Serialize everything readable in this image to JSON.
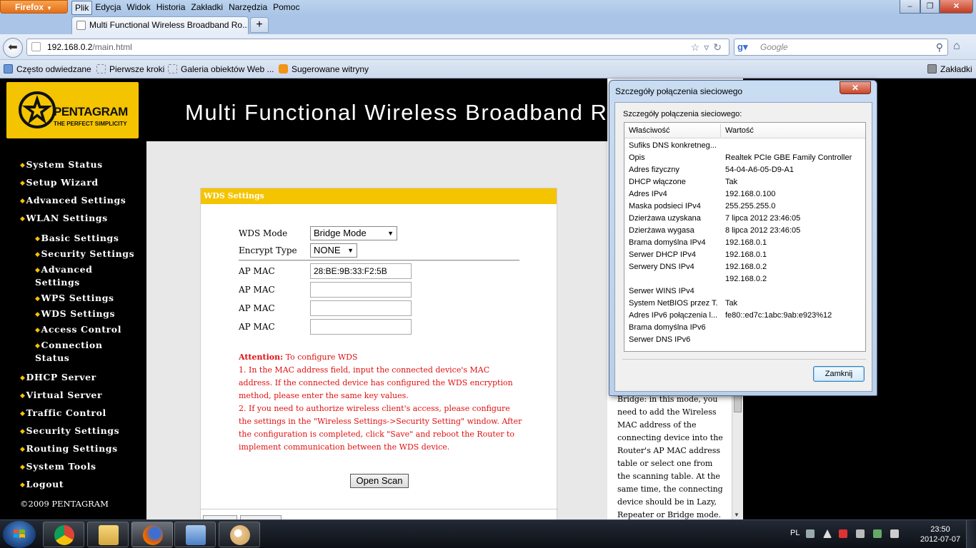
{
  "browser": {
    "app_button": "Firefox",
    "menu": [
      "Plik",
      "Edycja",
      "Widok",
      "Historia",
      "Zakładki",
      "Narzędzia",
      "Pomoc"
    ],
    "tab_title": "Multi Functional Wireless Broadband Ro...",
    "new_tab": "+",
    "url_host": "192.168.0.2",
    "url_path": "/main.html",
    "search_placeholder": "Google",
    "bookmarks": [
      "Często odwiedzane",
      "Pierwsze kroki",
      "Galeria obiektów Web ...",
      "Sugerowane witryny"
    ],
    "bookmarks_menu": "Zakładki",
    "window_controls": [
      "–",
      "❐",
      "✕"
    ]
  },
  "router": {
    "brand": "PENTAGRAM",
    "tagline": "THE PERFECT SIMPLICITY",
    "page_title": "Multi Functional Wireless Broadband Ro",
    "nav": {
      "system_status": "System Status",
      "setup_wizard": "Setup Wizard",
      "advanced_settings": "Advanced Settings",
      "wlan_settings": "WLAN Settings",
      "basic_settings": "Basic Settings",
      "security_settings_sub": "Security Settings",
      "advanced_settings_sub_1": "Advanced",
      "advanced_settings_sub_2": "Settings",
      "wps_settings": "WPS Settings",
      "wds_settings": "WDS Settings",
      "access_control": "Access Control",
      "connection_status_1": "Connection",
      "connection_status_2": "Status",
      "dhcp_server": "DHCP Server",
      "virtual_server": "Virtual Server",
      "traffic_control": "Traffic Control",
      "security_settings": "Security Settings",
      "routing_settings": "Routing Settings",
      "system_tools": "System Tools",
      "logout": "Logout"
    },
    "copyright": "©2009 PENTAGRAM",
    "wds": {
      "header": "WDS Settings",
      "mode_label": "WDS Mode",
      "mode_value": "Bridge Mode",
      "encrypt_label": "Encrypt Type",
      "encrypt_value": "NONE",
      "ap_mac_label": "AP MAC",
      "ap_mac_values": [
        "28:BE:9B:33:F2:5B",
        "",
        "",
        ""
      ],
      "attention_lead": "Attention:",
      "attention_intro": " To configure WDS",
      "attention_1": "1. In the MAC address field, input the connected device's MAC address. If the connected device has configured the WDS encryption method, please enter the same key values.",
      "attention_2": "2. If you need to authorize wireless client's access, please configure the settings in the \"Wireless Settings->Security Setting\" window. After the configuration is completed, click \"Save\" and reboot the Router to implement communication between the WDS device.",
      "open_scan": "Open Scan"
    },
    "help_text": "Bridge: in this mode, you need to add the Wireless MAC address of the connecting device into the Router's AP MAC address table or select one from the scanning table. At the same time, the connecting device should be in Lazy, Repeater or Bridge mode."
  },
  "dialog": {
    "title": "Szczegóły połączenia sieciowego",
    "subtitle": "Szczegóły połączenia sieciowego:",
    "col_property": "Właściwość",
    "col_value": "Wartość",
    "rows": [
      {
        "k": "Sufiks DNS konkretneg...",
        "v": ""
      },
      {
        "k": "Opis",
        "v": "Realtek PCIe GBE Family Controller"
      },
      {
        "k": "Adres fizyczny",
        "v": "54-04-A6-05-D9-A1"
      },
      {
        "k": "DHCP włączone",
        "v": "Tak"
      },
      {
        "k": "Adres IPv4",
        "v": "192.168.0.100"
      },
      {
        "k": "Maska podsieci IPv4",
        "v": "255.255.255.0"
      },
      {
        "k": "Dzierżawa uzyskana",
        "v": "7 lipca 2012 23:46:05"
      },
      {
        "k": "Dzierżawa wygasa",
        "v": "8 lipca 2012 23:46:05"
      },
      {
        "k": "Brama domyślna IPv4",
        "v": "192.168.0.1"
      },
      {
        "k": "Serwer DHCP IPv4",
        "v": "192.168.0.1"
      },
      {
        "k": "Serwery DNS IPv4",
        "v": "192.168.0.2"
      },
      {
        "k": "",
        "v": "192.168.0.2"
      },
      {
        "k": "Serwer WINS IPv4",
        "v": ""
      },
      {
        "k": "System NetBIOS przez T...",
        "v": "Tak"
      },
      {
        "k": "Adres IPv6 połączenia l...",
        "v": "fe80::ed7c:1abc:9ab:e923%12"
      },
      {
        "k": "Brama domyślna IPv6",
        "v": ""
      },
      {
        "k": "Serwer DNS IPv6",
        "v": ""
      }
    ],
    "close_button": "Zamknij"
  },
  "taskbar": {
    "language": "PL",
    "time": "23:50",
    "date": "2012-07-07"
  }
}
